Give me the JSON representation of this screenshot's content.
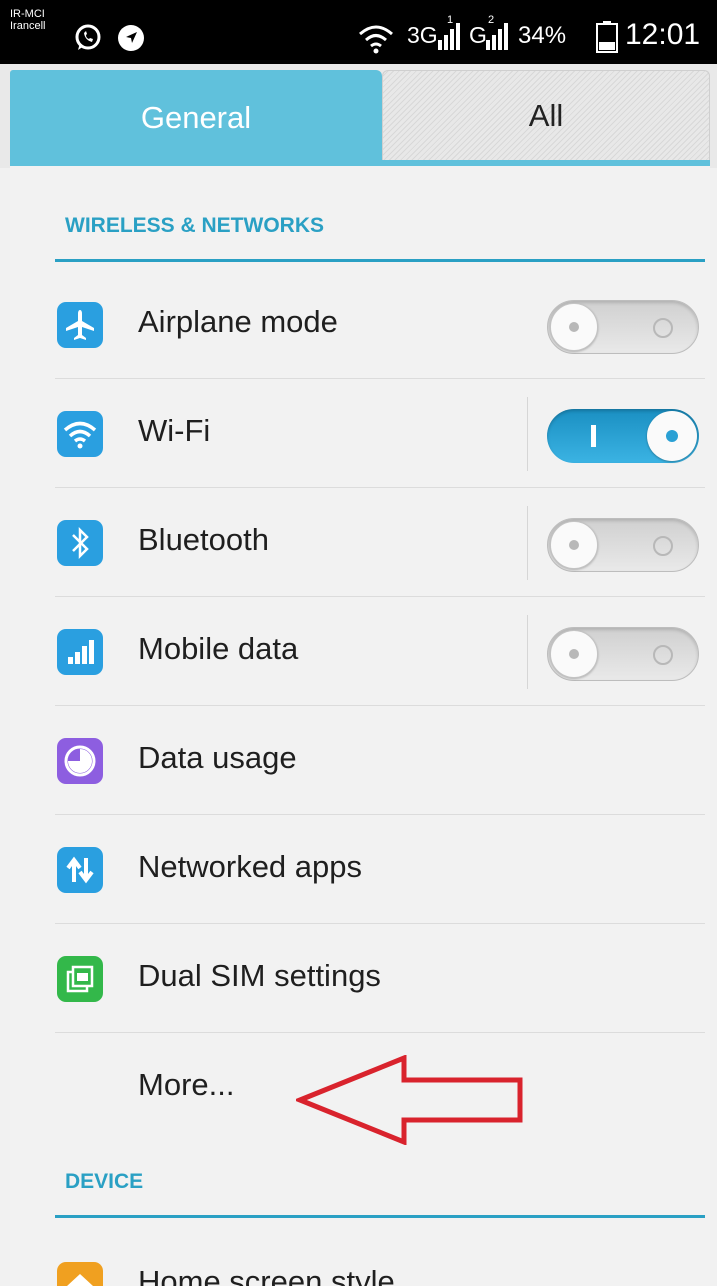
{
  "status_bar": {
    "carrier_line1": "IR-MCI",
    "carrier_line2": "Irancell",
    "network": "3G",
    "sim1_label": "1",
    "sim2_label": "G",
    "sim2_sub": "2",
    "battery": "34%",
    "time": "12:01",
    "icons": [
      "whatsapp-icon",
      "navigation-icon",
      "wifi-icon",
      "signal-icon",
      "battery-icon"
    ]
  },
  "tabs": [
    {
      "label": "General",
      "selected": true
    },
    {
      "label": "All",
      "selected": false
    }
  ],
  "sections": {
    "wireless": "WIRELESS & NETWORKS",
    "device": "DEVICE"
  },
  "rows": [
    {
      "label": "Airplane mode",
      "icon": "airplane-icon",
      "toggle": "off"
    },
    {
      "label": "Wi-Fi",
      "icon": "wifi-icon",
      "toggle": "on"
    },
    {
      "label": "Bluetooth",
      "icon": "bluetooth-icon",
      "toggle": "off"
    },
    {
      "label": "Mobile data",
      "icon": "mobile-data-icon",
      "toggle": "off"
    },
    {
      "label": "Data usage",
      "icon": "data-usage-icon"
    },
    {
      "label": "Networked apps",
      "icon": "networked-apps-icon"
    },
    {
      "label": "Dual SIM settings",
      "icon": "dual-sim-icon"
    },
    {
      "label": "More..."
    }
  ],
  "partial_row": {
    "label": "Home screen style",
    "icon": "home-icon"
  },
  "colors": {
    "accent": "#2aa0c4",
    "tab_selected": "#60c1dc",
    "arrow": "#d9232d",
    "toggle_on": "#2aa0d4"
  }
}
